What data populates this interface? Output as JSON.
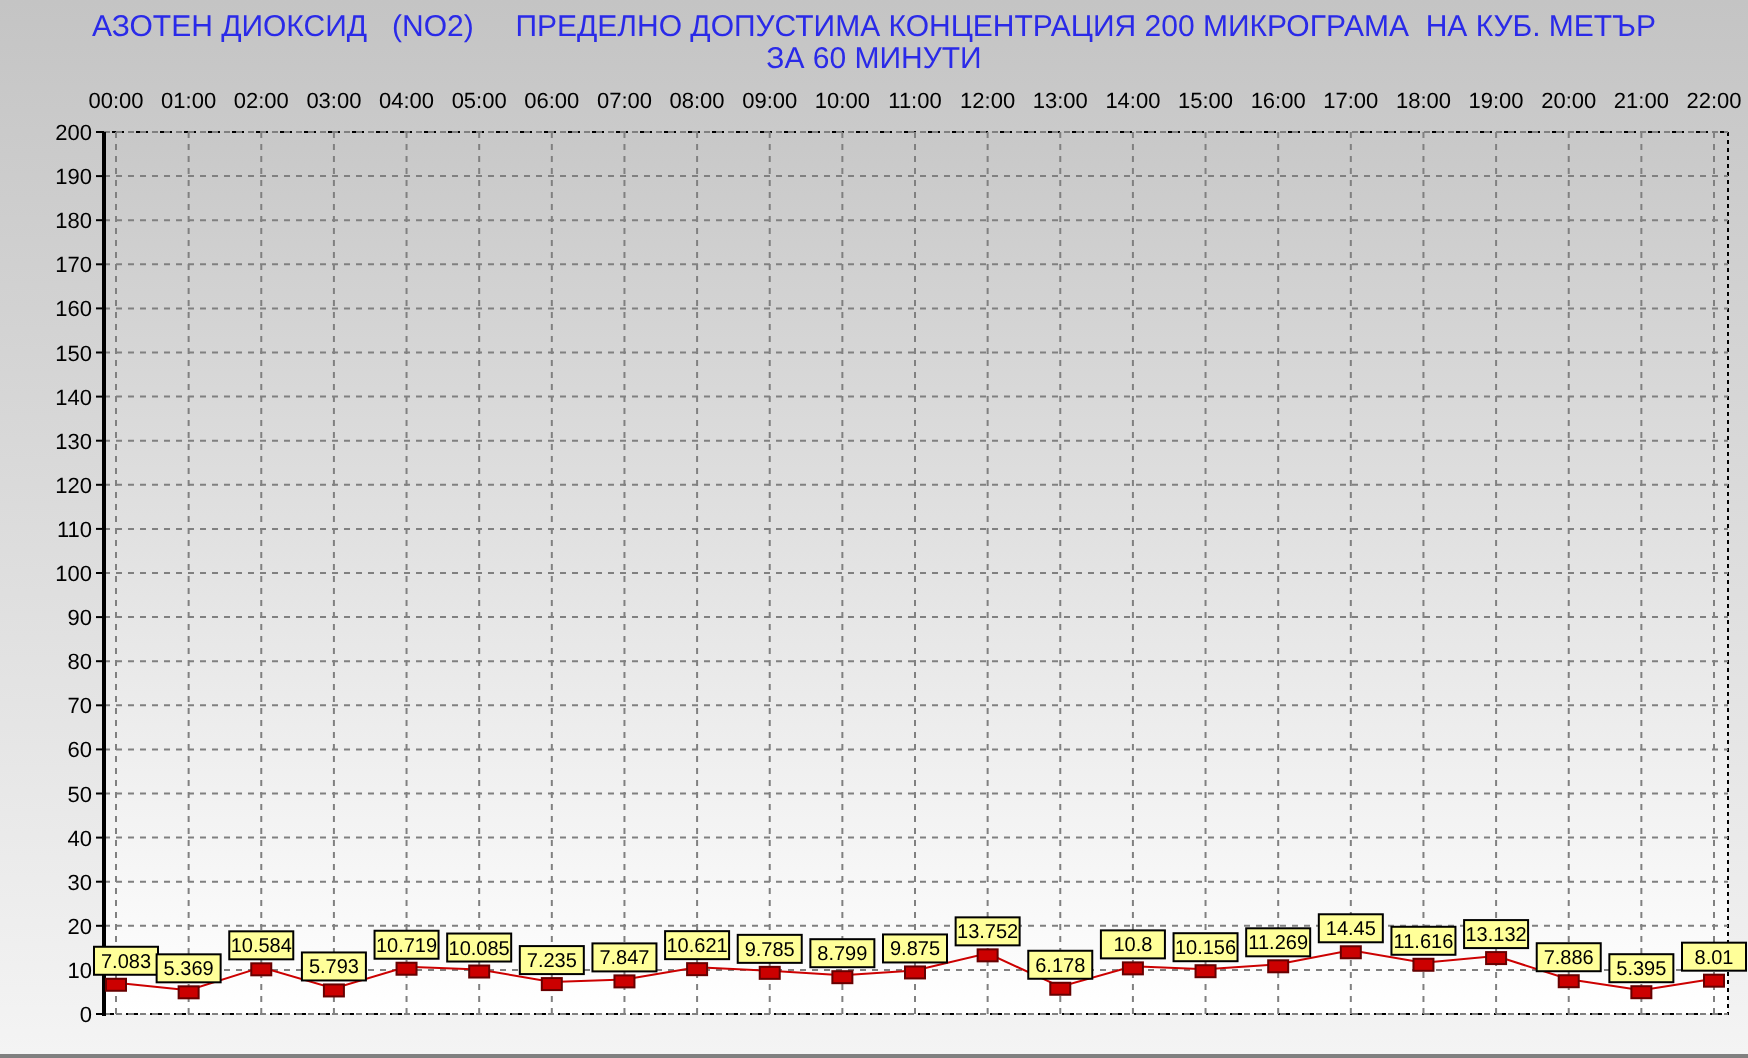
{
  "chart": {
    "title_lines": [
      "АЗОТЕН ДИОКСИД   (NO2)     ПРЕДЕЛНО ДОПУСТИМА КОНЦЕНТРАЦИЯ 200 МИКРОГРАМА  НА КУБ. МЕТЪР",
      "ЗА 60 МИНУТИ"
    ],
    "chart_data": {
      "type": "line",
      "categories": [
        "00:00",
        "01:00",
        "02:00",
        "03:00",
        "04:00",
        "05:00",
        "06:00",
        "07:00",
        "08:00",
        "09:00",
        "10:00",
        "11:00",
        "12:00",
        "13:00",
        "14:00",
        "15:00",
        "16:00",
        "17:00",
        "18:00",
        "19:00",
        "20:00",
        "21:00",
        "22:00"
      ],
      "series": [
        {
          "color": "#cc0000",
          "marker": true,
          "values": [
            7.083,
            5.369,
            10.584,
            5.793,
            10.719,
            10.085,
            7.235,
            7.847,
            10.621,
            9.785,
            8.799,
            9.875,
            13.752,
            6.178,
            10.8,
            10.156,
            11.269,
            14.45,
            11.616,
            13.132,
            7.886,
            5.395,
            8.01
          ]
        }
      ],
      "ylim": [
        0,
        200
      ],
      "yticks": [
        0,
        10,
        20,
        30,
        40,
        50,
        60,
        70,
        80,
        90,
        100,
        110,
        120,
        130,
        140,
        150,
        160,
        170,
        180,
        190,
        200
      ],
      "data_labels": true,
      "grid": true
    }
  }
}
